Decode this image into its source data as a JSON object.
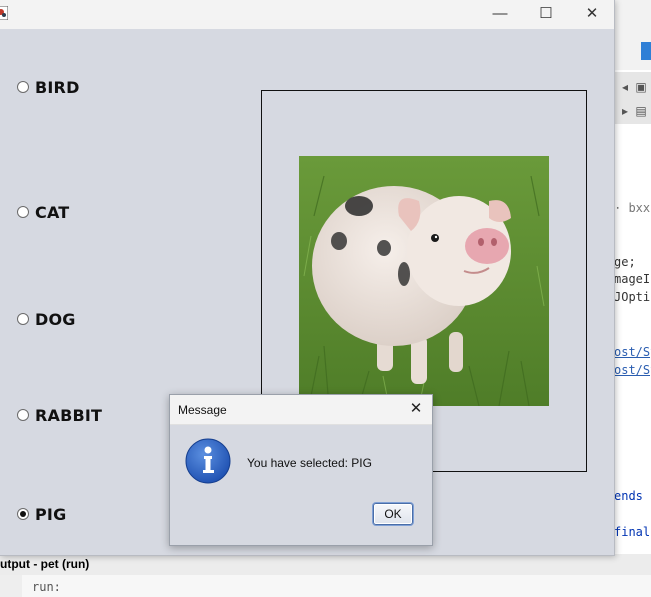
{
  "app_window": {
    "title": "",
    "controls": {
      "minimize": "—",
      "maximize": "☐",
      "close": "✕"
    },
    "options": [
      {
        "label": "BIRD",
        "selected": false
      },
      {
        "label": "CAT",
        "selected": false
      },
      {
        "label": "DOG",
        "selected": false
      },
      {
        "label": "RABBIT",
        "selected": false
      },
      {
        "label": "PIG",
        "selected": true
      }
    ],
    "image_description": "pig-photo"
  },
  "dialog": {
    "title": "Message",
    "close_glyph": "✕",
    "icon": "info-icon",
    "message": "You have selected: PIG",
    "ok_label": "OK"
  },
  "ide": {
    "code_fragments": [
      "bxxl",
      "ge;",
      "mageI",
      "JOptic",
      "ost/Sy",
      "ost/Sy",
      "ends",
      "final"
    ],
    "output_title": "utput - pet (run)",
    "output_text": "run:"
  },
  "colors": {
    "window_bg": "#d6d9e1",
    "titlebar_bg": "#f3f3f3",
    "info_blue": "#2b63c6",
    "ok_border": "#4a6ea8"
  }
}
